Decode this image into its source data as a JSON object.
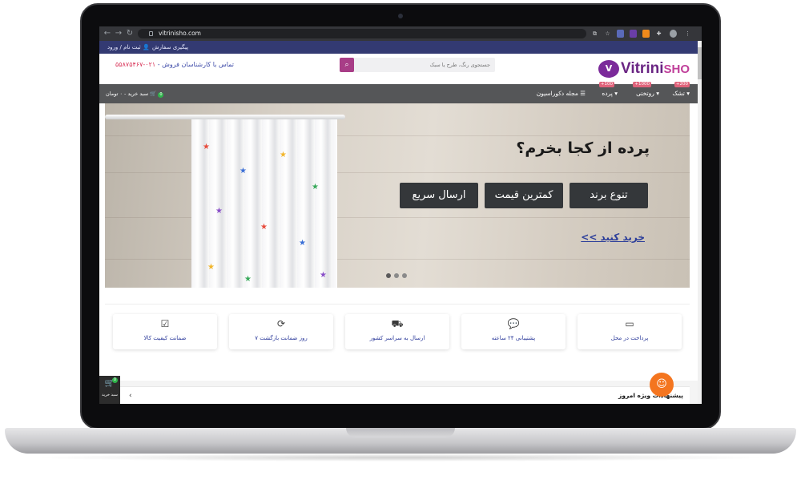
{
  "browser": {
    "url": "vitrinisho.com",
    "back_icon": "arrow-left-icon",
    "forward_icon": "arrow-right-icon",
    "reload_icon": "reload-icon"
  },
  "topbar": {
    "track_order": "پیگیری سفارش",
    "login": "ثبت نام / ورود"
  },
  "header": {
    "logo_mark": "V",
    "logo_text": "Vitrini",
    "logo_text_accent": "SHO",
    "search_placeholder": "جستجوی رنگ، طرح یا سبک",
    "contact_label": "تماس با کارشناسان فروش - ",
    "phone": "۰۲۱-۵۵۸۷۵۴۶۷"
  },
  "menu": {
    "items": [
      {
        "label": "تشک",
        "badge": "+200"
      },
      {
        "label": "روتختی",
        "badge": "+1000"
      },
      {
        "label": "پرده",
        "badge": "+100"
      }
    ],
    "magazine": "مجله دکوراسیون",
    "cart_label": "سبد خرید - ۰ تومان",
    "cart_count": "0"
  },
  "hero": {
    "title": "پرده از کجا بخرم؟",
    "chips": [
      "تنوع برند",
      "کمترین قیمت",
      "ارسال سریع"
    ],
    "cta": "خرید کنید >>",
    "slide_count": 3
  },
  "features": [
    {
      "icon": "credit-card-icon",
      "label": "پرداخت در محل"
    },
    {
      "icon": "chat-icon",
      "label": "پشتیبانی ۲۴ ساعته"
    },
    {
      "icon": "truck-icon",
      "label": "ارسال به سراسر کشور"
    },
    {
      "icon": "refresh-icon",
      "label": "۷ روز ضمانت بازگشت"
    },
    {
      "icon": "check-icon",
      "label": "ضمانت کیفیت کالا"
    }
  ],
  "specials": {
    "title": "پیشنهادات ویژه امروز"
  },
  "cart_float": {
    "label": "سبد خرید",
    "count": "0"
  }
}
